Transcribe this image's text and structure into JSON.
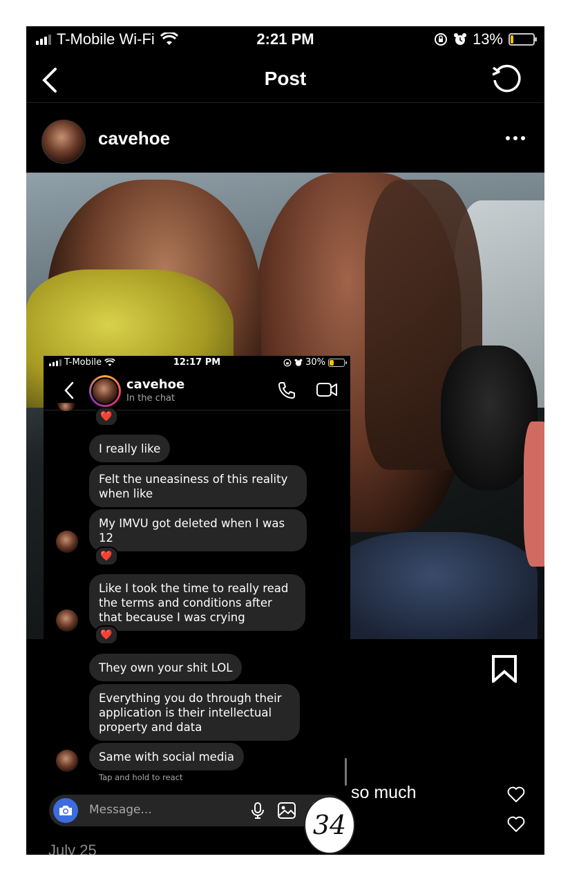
{
  "status_bar": {
    "carrier": "T-Mobile Wi-Fi",
    "time": "2:21 PM",
    "battery": "13%",
    "battery_level": 0.13
  },
  "nav": {
    "title": "Post"
  },
  "post": {
    "username": "cavehoe",
    "caption_fragment": "so much",
    "date": "July 25"
  },
  "dm_screenshot": {
    "status_bar": {
      "carrier": "T-Mobile",
      "time": "12:17 PM",
      "battery": "30%",
      "battery_level": 0.3
    },
    "header": {
      "name": "cavehoe",
      "subtitle": "In the chat"
    },
    "messages": [
      {
        "text": "I really like"
      },
      {
        "text": "Felt the uneasiness of this reality when like"
      },
      {
        "text": "My IMVU got deleted when I was 12"
      },
      {
        "text": "Like I took the time to really read the terms and conditions after that because I was crying"
      },
      {
        "text": "They own your shit LOL"
      },
      {
        "text": "Everything you do through their application is their intellectual property and data"
      },
      {
        "text": "Same with social media"
      }
    ],
    "hint": "Tap and hold to react",
    "composer_placeholder": "Message...",
    "reaction": "❤️"
  },
  "page_number": "34",
  "colors": {
    "background": "#000000",
    "bubble": "#262626",
    "camera_button": "#3d6ce0",
    "battery_fill": "#f5c400",
    "heart_reaction": "#ff3040"
  }
}
